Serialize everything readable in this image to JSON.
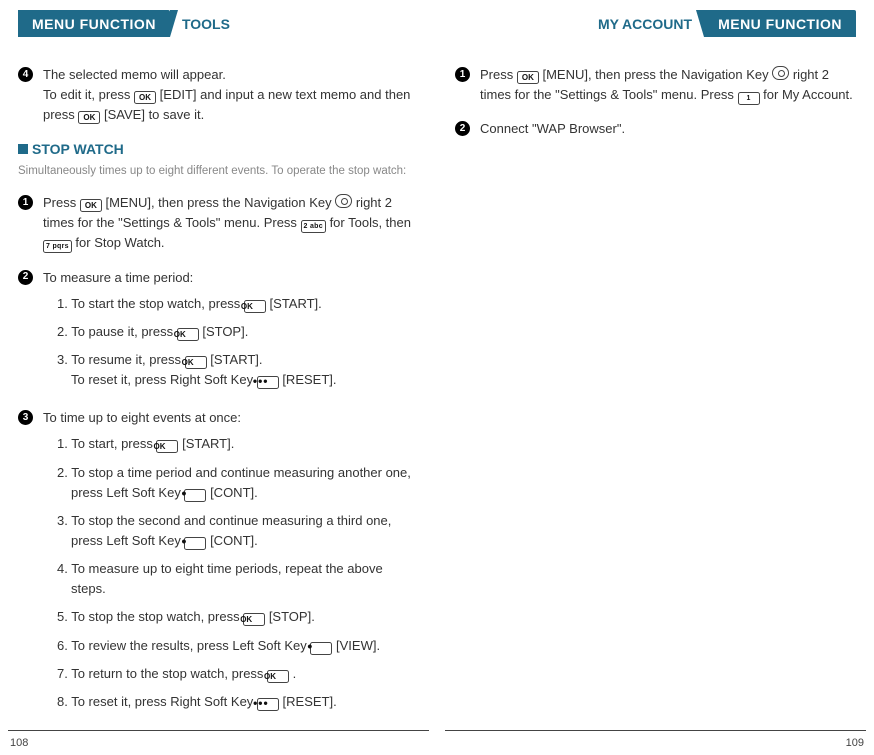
{
  "left": {
    "tab": "MENU FUNCTION",
    "section": "TOOLS",
    "step4_a": "The selected memo will appear.",
    "step4_b": "To edit it, press ",
    "step4_c": " [EDIT] and input a new text memo and then press ",
    "step4_d": " [SAVE] to save it.",
    "sw_heading": "STOP WATCH",
    "sw_note": "Simultaneously times up to eight different events. To operate the stop watch:",
    "s1_a": "Press ",
    "s1_b": " [MENU], then press the Navigation Key ",
    "s1_c": " right 2 times for the \"Settings & Tools\" menu. Press ",
    "s1_d": " for Tools, then ",
    "s1_e": " for Stop Watch.",
    "s2_head": "To measure a time period:",
    "s2_1a": "1. To start the stop watch, press ",
    "s2_1b": " [START].",
    "s2_2a": "2. To pause it, press ",
    "s2_2b": " [STOP].",
    "s2_3a": "3. To resume it, press ",
    "s2_3b": " [START].",
    "s2_3c": "To reset it, press Right Soft Key ",
    "s2_3d": " [RESET].",
    "s3_head": "To time up to eight events at once:",
    "s3_1a": "1. To start, press ",
    "s3_1b": " [START].",
    "s3_2a": "2. To stop a time period and continue measuring another one, press Left Soft Key ",
    "s3_2b": " [CONT].",
    "s3_3a": "3. To stop the second and continue measuring a third one, press Left Soft Key ",
    "s3_3b": " [CONT].",
    "s3_4": "4. To measure up to eight time periods, repeat the above steps.",
    "s3_5a": "5. To stop the stop watch, press ",
    "s3_5b": " [STOP].",
    "s3_6a": "6. To review the results, press Left Soft Key ",
    "s3_6b": " [VIEW].",
    "s3_7a": "7. To return to the stop watch, press ",
    "s3_7b": " .",
    "s3_8a": "8. To reset it, press Right Soft Key ",
    "s3_8b": " [RESET].",
    "page": "108"
  },
  "right": {
    "tab": "MENU FUNCTION",
    "section": "MY ACCOUNT",
    "s1_a": "Press ",
    "s1_b": " [MENU], then press the Navigation Key ",
    "s1_c": " right 2 times for the \"Settings & Tools\" menu. Press ",
    "s1_d": " for My Account.",
    "s2": "Connect \"WAP Browser\".",
    "page": "109"
  },
  "keys": {
    "ok": "OK",
    "k2": "2 abc",
    "k7": "7 pqrs",
    "k1": "1"
  }
}
